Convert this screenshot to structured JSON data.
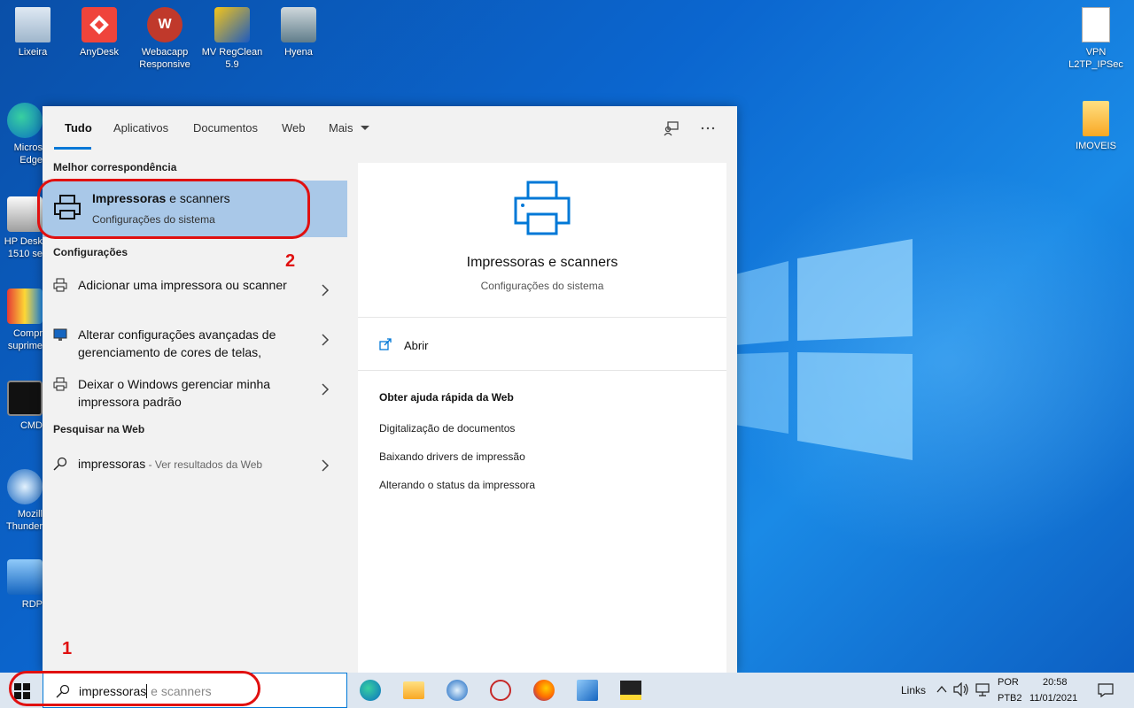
{
  "desktop": {
    "icons_left": [
      {
        "label": "Lixeira",
        "icon": "recycle-bin-icon"
      },
      {
        "label": "AnyDesk",
        "icon": "anydesk-icon"
      },
      {
        "label": "Webacapp Responsive",
        "icon": "webacapp-icon"
      },
      {
        "label": "MV RegClean 5.9",
        "icon": "regclean-icon"
      },
      {
        "label": "Hyena",
        "icon": "hyena-icon"
      },
      {
        "label": "Micros Edge",
        "icon": "edge-icon"
      },
      {
        "label": "HP Desk 1510 se",
        "icon": "printer-icon"
      },
      {
        "label": "Compr suprime",
        "icon": "supplies-icon"
      },
      {
        "label": "CMD",
        "icon": "cmd-icon"
      },
      {
        "label": "Mozill Thunder",
        "icon": "thunderbird-icon"
      },
      {
        "label": "RDP",
        "icon": "rdp-icon"
      }
    ],
    "icons_right": [
      {
        "label": "VPN L2TP_IPSec",
        "icon": "document-icon"
      },
      {
        "label": "IMOVEIS",
        "icon": "folder-icon"
      }
    ],
    "accent": "#0078d7"
  },
  "search": {
    "tabs": [
      "Tudo",
      "Aplicativos",
      "Documentos",
      "Web",
      "Mais"
    ],
    "best_match_header": "Melhor correspondência",
    "best_match": {
      "title_bold": "Impressoras",
      "title_rest": " e scanners",
      "subtitle": "Configurações do sistema"
    },
    "settings_header": "Configurações",
    "settings_items": [
      {
        "text": "Adicionar uma impressora ou scanner",
        "icon": "printer-icon"
      },
      {
        "text": "Alterar configurações avançadas de gerenciamento de cores de telas,",
        "icon": "monitor-icon"
      },
      {
        "text": "Deixar o Windows gerenciar minha impressora padrão",
        "icon": "printer-icon"
      }
    ],
    "web_header": "Pesquisar na Web",
    "web_item": {
      "query": "impressoras",
      "suffix": " - Ver resultados da Web"
    },
    "preview": {
      "title": "Impressoras e scanners",
      "subtitle": "Configurações do sistema",
      "open_label": "Abrir",
      "help_header": "Obter ajuda rápida da Web",
      "help_links": [
        "Digitalização de documentos",
        "Baixando drivers de impressão",
        "Alterando o status da impressora"
      ]
    },
    "query_typed": "impressoras",
    "query_suggestion": " e scanners"
  },
  "annotations": {
    "one": "1",
    "two": "2"
  },
  "tray": {
    "links": "Links",
    "lang1": "POR",
    "lang2": "PTB2",
    "time": "20:58",
    "date": "11/01/2021"
  }
}
